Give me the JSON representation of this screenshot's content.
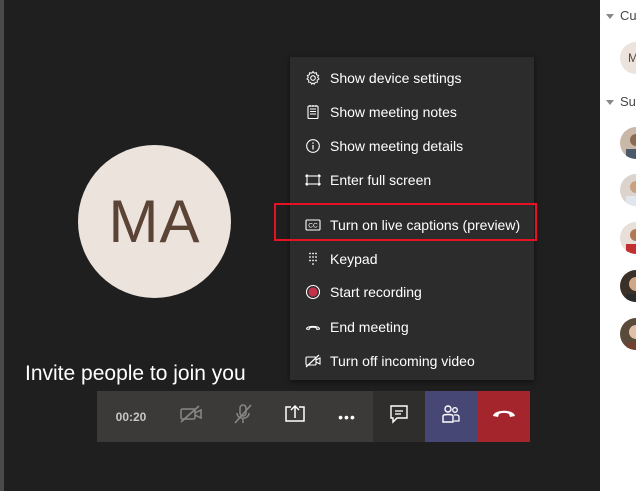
{
  "stage": {
    "avatar_initials": "MA",
    "invite_text": "Invite people to join you"
  },
  "menu": {
    "items": [
      {
        "label": "Show device settings",
        "icon": "gear-icon"
      },
      {
        "label": "Show meeting notes",
        "icon": "notes-icon"
      },
      {
        "label": "Show meeting details",
        "icon": "info-icon"
      },
      {
        "label": "Enter full screen",
        "icon": "fullscreen-icon"
      },
      {
        "label": "Turn on live captions (preview)",
        "icon": "cc-icon"
      },
      {
        "label": "Keypad",
        "icon": "keypad-icon"
      },
      {
        "label": "Start recording",
        "icon": "record-icon"
      },
      {
        "label": "End meeting",
        "icon": "end-meeting-icon"
      },
      {
        "label": "Turn off incoming video",
        "icon": "video-off-icon"
      }
    ]
  },
  "toolbar": {
    "timer": "00:20",
    "more_glyph": "•••"
  },
  "right_panel": {
    "section_current": "Cu",
    "section_suggested": "Su",
    "current_avatar_initial": "M"
  },
  "colors": {
    "highlight": "#e81123",
    "hangup": "#a4262c",
    "participants": "#464775",
    "record": "#c4314b"
  }
}
